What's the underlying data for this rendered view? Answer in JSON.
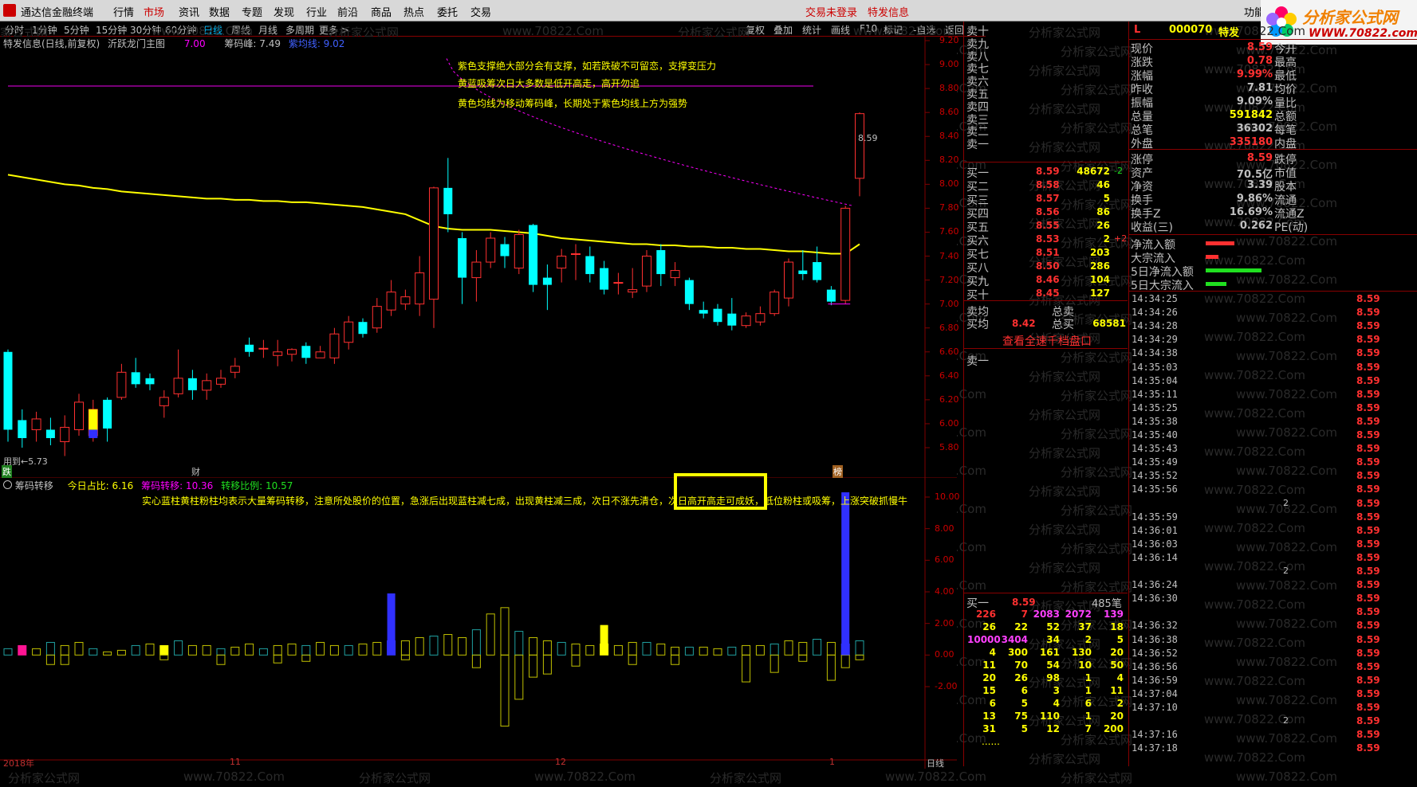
{
  "menubar": {
    "app_title": "通达信金融终端",
    "items": [
      "行情",
      "市场",
      "资讯",
      "数据",
      "专题",
      "发现",
      "行业",
      "前沿",
      "商品",
      "热点",
      "委托",
      "交易"
    ],
    "active_index": 1,
    "right_items": [
      "交易未登录",
      "特发信息"
    ],
    "far_right": "功能"
  },
  "brand": {
    "name": "分析家公式网",
    "url": "WWW.70822.com"
  },
  "periodbar": {
    "tabs": [
      "分时",
      "1分钟",
      "5分钟",
      "15分钟",
      "30分钟",
      "60分钟",
      "日线",
      "周线",
      "月线",
      "多周期",
      "更多 >"
    ],
    "active_index": 6,
    "tools": [
      "复权",
      "叠加",
      "统计",
      "画线",
      "F10",
      "标记",
      "-自选",
      "返回"
    ]
  },
  "main_info": {
    "stock": "特发信息(日线,前复权)",
    "formula": "沂跃龙门主图",
    "v1": "7.00",
    "chip_label": "筹码峰: 7.49",
    "purple_label": "紫均线: 9.02"
  },
  "main_notes": [
    "紫色支撑绝大部分会有支撑，如若跌破不可留恋，支撑变压力",
    "黄蓝吸筹次日大多数是低开高走，高开勿追",
    "黄色均线为移动筹码峰，长期处于紫色均线上方为强势"
  ],
  "main_axis": [
    "9.20",
    "9.00",
    "8.80",
    "8.60",
    "8.40",
    "8.20",
    "8.00",
    "7.80",
    "7.60",
    "7.40",
    "7.20",
    "7.00",
    "6.80",
    "6.60",
    "6.40",
    "6.20",
    "6.00",
    "5.80"
  ],
  "price_label": "8.59",
  "bottom_marks": {
    "left": "跌",
    "cai": "财",
    "bang": "榜",
    "low_label": "←5.73"
  },
  "sub_info": {
    "title": "筹码转移",
    "l1": "今日占比: 6.16",
    "l2": "筹码转移: 10.36",
    "l3": "转移比例: 10.57"
  },
  "sub_note": "实心蓝柱黄柱粉柱均表示大量筹码转移，注意所处股价的位置，急涨后出现蓝柱减七成，出现黄柱减三成，次日不涨先清仓，次日高开高走可成妖，低位粉柱或吸筹，上涨突破抓慢牛",
  "sub_axis": [
    "10.00",
    "8.00",
    "6.00",
    "4.00",
    "2.00",
    "0.00",
    "-2.00"
  ],
  "time_axis": [
    "2018年",
    "11",
    "12",
    "1"
  ],
  "time_axis_right": "日线",
  "orderbook": {
    "sell": [
      {
        "label": "卖十"
      },
      {
        "label": "卖九"
      },
      {
        "label": "卖八"
      },
      {
        "label": "卖七"
      },
      {
        "label": "卖六"
      },
      {
        "label": "卖五"
      },
      {
        "label": "卖四"
      },
      {
        "label": "卖三"
      },
      {
        "label": "卖二"
      },
      {
        "label": "卖一"
      }
    ],
    "buy": [
      {
        "label": "买一",
        "price": "8.59",
        "vol": "48672",
        "chg": "-2"
      },
      {
        "label": "买二",
        "price": "8.58",
        "vol": "46",
        "chg": ""
      },
      {
        "label": "买三",
        "price": "8.57",
        "vol": "5",
        "chg": ""
      },
      {
        "label": "买四",
        "price": "8.56",
        "vol": "86",
        "chg": ""
      },
      {
        "label": "买五",
        "price": "8.55",
        "vol": "26",
        "chg": ""
      },
      {
        "label": "买六",
        "price": "8.53",
        "vol": "2",
        "chg": "+2"
      },
      {
        "label": "买七",
        "price": "8.51",
        "vol": "203",
        "chg": ""
      },
      {
        "label": "买八",
        "price": "8.50",
        "vol": "286",
        "chg": ""
      },
      {
        "label": "买九",
        "price": "8.46",
        "vol": "104",
        "chg": ""
      },
      {
        "label": "买十",
        "price": "8.45",
        "vol": "127",
        "chg": ""
      }
    ],
    "sell_avg_label": "卖均",
    "total_sell_label": "总卖",
    "buy_avg_label": "买均",
    "buy_avg_price": "8.42",
    "total_buy_label": "总买",
    "total_buy": "68581",
    "full_link": "查看全速千档盘口",
    "sell1_label": "卖一",
    "buy1_label": "买一",
    "buy1_price": "8.59",
    "buy1_count": "485笔",
    "queue": [
      [
        "226",
        "7",
        "2083",
        "2072",
        "139"
      ],
      [
        "26",
        "22",
        "52",
        "37",
        "18"
      ],
      [
        "10000",
        "3404",
        "34",
        "2",
        "5"
      ],
      [
        "4",
        "300",
        "161",
        "130",
        "20"
      ],
      [
        "11",
        "70",
        "54",
        "10",
        "50"
      ],
      [
        "20",
        "26",
        "98",
        "1",
        "4"
      ],
      [
        "15",
        "6",
        "3",
        "1",
        "11"
      ],
      [
        "6",
        "5",
        "4",
        "6",
        "2"
      ],
      [
        "13",
        "75",
        "110",
        "1",
        "20"
      ],
      [
        "31",
        "5",
        "12",
        "7",
        "200"
      ]
    ],
    "queue_more": "......"
  },
  "quote": {
    "code": "000070",
    "name": "特发",
    "flag": "L",
    "rows": [
      {
        "l": "现价",
        "v": "8.59",
        "c": "#ff3030",
        "r": "今开"
      },
      {
        "l": "涨跌",
        "v": "0.78",
        "c": "#ff3030",
        "r": "最高"
      },
      {
        "l": "涨幅",
        "v": "9.99%",
        "c": "#ff3030",
        "r": "最低"
      },
      {
        "l": "昨收",
        "v": "7.81",
        "c": "#c0c0c0",
        "r": "均价"
      },
      {
        "l": "振幅",
        "v": "9.09%",
        "c": "#c0c0c0",
        "r": "量比"
      },
      {
        "l": "总量",
        "v": "591842",
        "c": "#ffff00",
        "r": "总额"
      },
      {
        "l": "总笔",
        "v": "36302",
        "c": "#c0c0c0",
        "r": "每笔"
      },
      {
        "l": "外盘",
        "v": "335180",
        "c": "#ff3030",
        "r": "内盘"
      },
      {
        "l": "涨停",
        "v": "8.59",
        "c": "#ff3030",
        "r": "跌停"
      },
      {
        "l": "资产",
        "v": "70.5亿",
        "c": "#c0c0c0",
        "r": "市值"
      },
      {
        "l": "净资",
        "v": "3.39",
        "c": "#c0c0c0",
        "r": "股本"
      },
      {
        "l": "换手",
        "v": "9.86%",
        "c": "#c0c0c0",
        "r": "流通"
      },
      {
        "l": "换手Z",
        "v": "16.69%",
        "c": "#c0c0c0",
        "r": "流通Z"
      },
      {
        "l": "收益(三)",
        "v": "0.262",
        "c": "#c0c0c0",
        "r": "PE(动)"
      }
    ],
    "flows": [
      {
        "l": "净流入额",
        "c": "#ff3030",
        "w": 36
      },
      {
        "l": "大宗流入",
        "c": "#ff3030",
        "w": 16
      },
      {
        "l": "5日净流入额",
        "c": "#20e020",
        "w": 70
      },
      {
        "l": "5日大宗流入",
        "c": "#20e020",
        "w": 26
      }
    ]
  },
  "ticks": [
    {
      "t": "14:34:25",
      "v": "",
      "p": "8.59"
    },
    {
      "t": "14:34:26",
      "v": "",
      "p": "8.59"
    },
    {
      "t": "14:34:28",
      "v": "",
      "p": "8.59"
    },
    {
      "t": "14:34:29",
      "v": "",
      "p": "8.59"
    },
    {
      "t": "14:34:38",
      "v": "",
      "p": "8.59"
    },
    {
      "t": "14:35:03",
      "v": "",
      "p": "8.59"
    },
    {
      "t": "14:35:04",
      "v": "",
      "p": "8.59"
    },
    {
      "t": "14:35:11",
      "v": "",
      "p": "8.59"
    },
    {
      "t": "14:35:25",
      "v": "",
      "p": "8.59"
    },
    {
      "t": "14:35:38",
      "v": "",
      "p": "8.59"
    },
    {
      "t": "14:35:40",
      "v": "",
      "p": "8.59"
    },
    {
      "t": "14:35:43",
      "v": "",
      "p": "8.59"
    },
    {
      "t": "14:35:49",
      "v": "",
      "p": "8.59"
    },
    {
      "t": "14:35:52",
      "v": "",
      "p": "8.59"
    },
    {
      "t": "14:35:56",
      "v": "",
      "p": "8.59"
    },
    {
      "t": "",
      "v": "2",
      "p": "8.59"
    },
    {
      "t": "14:35:59",
      "v": "",
      "p": "8.59"
    },
    {
      "t": "14:36:01",
      "v": "",
      "p": "8.59"
    },
    {
      "t": "14:36:03",
      "v": "",
      "p": "8.59"
    },
    {
      "t": "14:36:14",
      "v": "",
      "p": "8.59"
    },
    {
      "t": "",
      "v": "2",
      "p": "8.59"
    },
    {
      "t": "14:36:24",
      "v": "",
      "p": "8.59"
    },
    {
      "t": "14:36:30",
      "v": "",
      "p": "8.59"
    },
    {
      "t": "",
      "v": "",
      "p": "8.59"
    },
    {
      "t": "14:36:32",
      "v": "",
      "p": "8.59"
    },
    {
      "t": "14:36:38",
      "v": "",
      "p": "8.59"
    },
    {
      "t": "14:36:52",
      "v": "",
      "p": "8.59"
    },
    {
      "t": "14:36:56",
      "v": "",
      "p": "8.59"
    },
    {
      "t": "14:36:59",
      "v": "",
      "p": "8.59"
    },
    {
      "t": "14:37:04",
      "v": "",
      "p": "8.59"
    },
    {
      "t": "14:37:10",
      "v": "",
      "p": "8.59"
    },
    {
      "t": "",
      "v": "2",
      "p": "8.59"
    },
    {
      "t": "14:37:16",
      "v": "",
      "p": "8.59"
    },
    {
      "t": "14:37:18",
      "v": "",
      "p": "8.59"
    }
  ],
  "candles": [
    {
      "o": 6.6,
      "c": 5.95,
      "h": 6.62,
      "l": 5.85
    },
    {
      "o": 6.03,
      "c": 5.88,
      "h": 6.12,
      "l": 5.8
    },
    {
      "o": 5.95,
      "c": 6.04,
      "h": 6.1,
      "l": 5.85
    },
    {
      "o": 5.95,
      "c": 5.88,
      "h": 6.05,
      "l": 5.82
    },
    {
      "o": 5.85,
      "c": 5.97,
      "h": 6.07,
      "l": 5.73
    },
    {
      "o": 5.95,
      "c": 6.18,
      "h": 6.25,
      "l": 5.9
    },
    {
      "o": 5.9,
      "c": 6.12,
      "h": 6.2,
      "l": 5.85
    },
    {
      "o": 6.2,
      "c": 5.96,
      "h": 6.22,
      "l": 5.85
    },
    {
      "o": 6.22,
      "c": 6.43,
      "h": 6.5,
      "l": 6.2
    },
    {
      "o": 6.43,
      "c": 6.33,
      "h": 6.55,
      "l": 6.3
    },
    {
      "o": 6.38,
      "c": 6.33,
      "h": 6.42,
      "l": 6.28
    },
    {
      "o": 6.15,
      "c": 6.22,
      "h": 6.28,
      "l": 6.05
    },
    {
      "o": 6.25,
      "c": 6.38,
      "h": 6.62,
      "l": 6.22
    },
    {
      "o": 6.38,
      "c": 6.28,
      "h": 6.45,
      "l": 6.2
    },
    {
      "o": 6.28,
      "c": 6.36,
      "h": 6.42,
      "l": 6.2
    },
    {
      "o": 6.33,
      "c": 6.38,
      "h": 6.45,
      "l": 6.3
    },
    {
      "o": 6.43,
      "c": 6.48,
      "h": 6.55,
      "l": 6.38
    },
    {
      "o": 6.66,
      "c": 6.6,
      "h": 6.72,
      "l": 6.56
    },
    {
      "o": 6.63,
      "c": 6.63,
      "h": 6.7,
      "l": 6.55
    },
    {
      "o": 6.57,
      "c": 6.6,
      "h": 6.7,
      "l": 6.48
    },
    {
      "o": 6.58,
      "c": 6.62,
      "h": 6.63,
      "l": 6.52
    },
    {
      "o": 6.65,
      "c": 6.55,
      "h": 6.68,
      "l": 6.5
    },
    {
      "o": 6.55,
      "c": 6.6,
      "h": 6.65,
      "l": 6.55
    },
    {
      "o": 6.55,
      "c": 6.75,
      "h": 6.8,
      "l": 6.5
    },
    {
      "o": 6.68,
      "c": 6.85,
      "h": 6.9,
      "l": 6.62
    },
    {
      "o": 6.85,
      "c": 6.75,
      "h": 6.88,
      "l": 6.72
    },
    {
      "o": 6.8,
      "c": 6.98,
      "h": 7.05,
      "l": 6.76
    },
    {
      "o": 6.95,
      "c": 7.1,
      "h": 7.2,
      "l": 6.9
    },
    {
      "o": 7.0,
      "c": 7.06,
      "h": 7.12,
      "l": 6.95
    },
    {
      "o": 7.0,
      "c": 7.26,
      "h": 7.4,
      "l": 6.9
    },
    {
      "o": 7.04,
      "c": 7.97,
      "h": 7.98,
      "l": 6.8
    },
    {
      "o": 7.97,
      "c": 7.75,
      "h": 8.22,
      "l": 7.6
    },
    {
      "o": 7.55,
      "c": 7.22,
      "h": 7.6,
      "l": 7.0
    },
    {
      "o": 7.22,
      "c": 7.35,
      "h": 7.45,
      "l": 7.02
    },
    {
      "o": 7.35,
      "c": 7.55,
      "h": 7.6,
      "l": 7.3
    },
    {
      "o": 7.5,
      "c": 7.4,
      "h": 7.56,
      "l": 7.3
    },
    {
      "o": 7.3,
      "c": 7.58,
      "h": 7.62,
      "l": 7.25
    },
    {
      "o": 7.66,
      "c": 7.16,
      "h": 7.67,
      "l": 7.1
    },
    {
      "o": 7.22,
      "c": 7.16,
      "h": 7.33,
      "l": 6.95
    },
    {
      "o": 7.3,
      "c": 7.4,
      "h": 7.46,
      "l": 7.18
    },
    {
      "o": 7.42,
      "c": 7.42,
      "h": 7.5,
      "l": 7.2
    },
    {
      "o": 7.4,
      "c": 7.25,
      "h": 7.48,
      "l": 7.18
    },
    {
      "o": 7.3,
      "c": 7.12,
      "h": 7.36,
      "l": 7.08
    },
    {
      "o": 7.18,
      "c": 7.18,
      "h": 7.26,
      "l": 7.08
    },
    {
      "o": 7.1,
      "c": 7.12,
      "h": 7.3,
      "l": 7.05
    },
    {
      "o": 7.15,
      "c": 7.4,
      "h": 7.45,
      "l": 7.1
    },
    {
      "o": 7.45,
      "c": 7.25,
      "h": 7.5,
      "l": 7.15
    },
    {
      "o": 7.22,
      "c": 7.28,
      "h": 7.35,
      "l": 7.15
    },
    {
      "o": 7.2,
      "c": 7.0,
      "h": 7.22,
      "l": 6.95
    },
    {
      "o": 6.95,
      "c": 6.92,
      "h": 7.02,
      "l": 6.88
    },
    {
      "o": 6.96,
      "c": 6.85,
      "h": 7.0,
      "l": 6.82
    },
    {
      "o": 6.92,
      "c": 6.82,
      "h": 7.05,
      "l": 6.78
    },
    {
      "o": 6.82,
      "c": 6.9,
      "h": 6.93,
      "l": 6.8
    },
    {
      "o": 6.85,
      "c": 6.92,
      "h": 6.98,
      "l": 6.82
    },
    {
      "o": 6.92,
      "c": 7.1,
      "h": 7.12,
      "l": 6.9
    },
    {
      "o": 7.05,
      "c": 7.35,
      "h": 7.38,
      "l": 6.98
    },
    {
      "o": 7.28,
      "c": 7.25,
      "h": 7.45,
      "l": 7.2
    },
    {
      "o": 7.35,
      "c": 7.2,
      "h": 7.48,
      "l": 7.18
    },
    {
      "o": 7.12,
      "c": 7.02,
      "h": 7.15,
      "l": 6.99
    },
    {
      "o": 7.03,
      "c": 7.8,
      "h": 7.82,
      "l": 7.0
    },
    {
      "o": 8.05,
      "c": 8.59,
      "h": 8.6,
      "l": 7.9
    }
  ],
  "colors": {
    "up": "#ff3030",
    "down": "#00ffff",
    "ma_yellow": "#ffff00",
    "ma_purple": "#ff00ff",
    "axis": "#ff3030",
    "grid": "#800000"
  }
}
